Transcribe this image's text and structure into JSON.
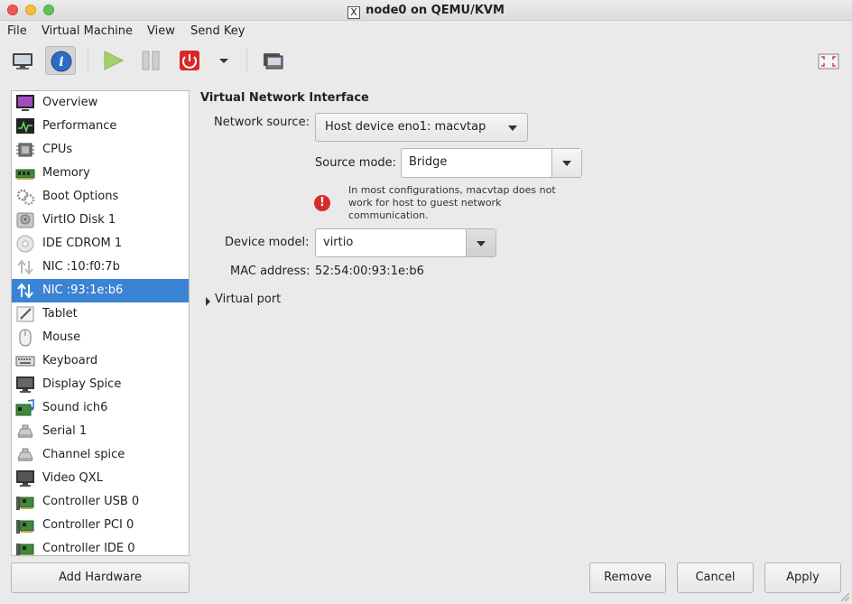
{
  "window": {
    "title": "node0 on QEMU/KVM",
    "x_logo": "X"
  },
  "menu": [
    "File",
    "Virtual Machine",
    "View",
    "Send Key"
  ],
  "toolbar": {
    "buttons": [
      "monitor-icon",
      "info-icon",
      "play-icon",
      "pause-icon",
      "power-icon",
      "dropdown-arrow-icon",
      "screenshot-icon",
      "fullscreen-icon"
    ]
  },
  "sidebar": {
    "items": [
      {
        "label": "Overview",
        "icon": "overview-icon"
      },
      {
        "label": "Performance",
        "icon": "performance-icon"
      },
      {
        "label": "CPUs",
        "icon": "cpu-icon"
      },
      {
        "label": "Memory",
        "icon": "memory-icon"
      },
      {
        "label": "Boot Options",
        "icon": "boot-options-icon"
      },
      {
        "label": "VirtIO Disk 1",
        "icon": "disk-icon"
      },
      {
        "label": "IDE CDROM 1",
        "icon": "cdrom-icon"
      },
      {
        "label": "NIC :10:f0:7b",
        "icon": "nic-icon"
      },
      {
        "label": "NIC :93:1e:b6",
        "icon": "nic-icon"
      },
      {
        "label": "Tablet",
        "icon": "tablet-icon"
      },
      {
        "label": "Mouse",
        "icon": "mouse-icon"
      },
      {
        "label": "Keyboard",
        "icon": "keyboard-icon"
      },
      {
        "label": "Display Spice",
        "icon": "display-icon"
      },
      {
        "label": "Sound ich6",
        "icon": "sound-icon"
      },
      {
        "label": "Serial 1",
        "icon": "serial-icon"
      },
      {
        "label": "Channel spice",
        "icon": "channel-icon"
      },
      {
        "label": "Video QXL",
        "icon": "video-icon"
      },
      {
        "label": "Controller USB 0",
        "icon": "controller-icon"
      },
      {
        "label": "Controller PCI 0",
        "icon": "controller-icon"
      },
      {
        "label": "Controller IDE 0",
        "icon": "controller-icon"
      }
    ],
    "selected": "NIC :93:1e:b6",
    "add_hardware": "Add Hardware"
  },
  "details": {
    "section_title": "Virtual Network Interface",
    "network_source_label": "Network source:",
    "network_source_value": "Host device eno1: macvtap",
    "source_mode_label": "Source mode:",
    "source_mode_value": "Bridge",
    "warning_text": "In most configurations, macvtap does not work for host to guest network communication.",
    "device_model_label": "Device model:",
    "device_model_value": "virtio",
    "mac_label": "MAC address:",
    "mac_value": "52:54:00:93:1e:b6",
    "virtual_port_label": "Virtual port"
  },
  "actions": {
    "remove": "Remove",
    "cancel": "Cancel",
    "apply": "Apply"
  },
  "colors": {
    "selection": "#3b83d5",
    "warning": "#d42c2c"
  }
}
